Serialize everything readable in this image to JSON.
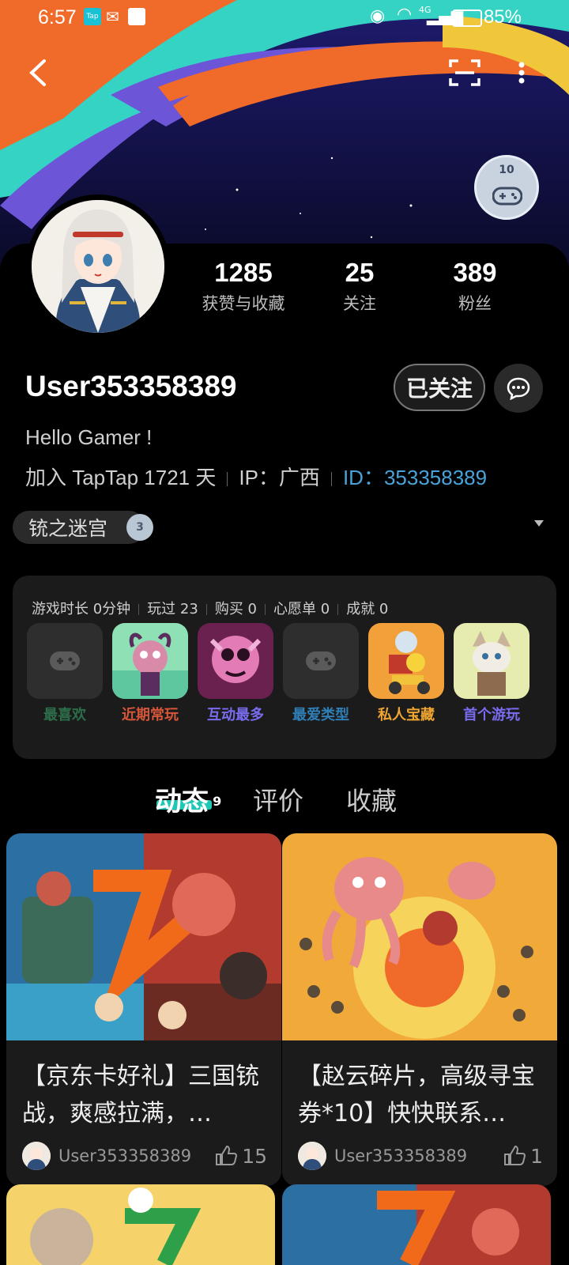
{
  "status_bar": {
    "time": "6:57",
    "battery": "85%",
    "network": "4G"
  },
  "badge": {
    "value": "10"
  },
  "stats": [
    {
      "value": "1285",
      "label": "获赞与收藏"
    },
    {
      "value": "25",
      "label": "关注"
    },
    {
      "value": "389",
      "label": "粉丝"
    }
  ],
  "profile": {
    "username": "User353358389",
    "follow_label": "已关注",
    "bio": "Hello Gamer !",
    "joined": "加入 TapTap 1721 天",
    "ip": "IP：广西",
    "id_label": "ID：",
    "id_value": "353358389",
    "guild": "铳之迷宫",
    "guild_level": "3"
  },
  "game_stats": [
    "游戏时长 0分钟",
    "玩过 23",
    "购买 0",
    "心愿单 0",
    "成就 0"
  ],
  "game_tiles": [
    {
      "label": "最喜欢",
      "color": "#2c6e49"
    },
    {
      "label": "近期常玩",
      "color": "#d6563a"
    },
    {
      "label": "互动最多",
      "color": "#7a6cf0"
    },
    {
      "label": "最爱类型",
      "color": "#2f7fb6"
    },
    {
      "label": "私人宝藏",
      "color": "#f0a630"
    },
    {
      "label": "首个游玩",
      "color": "#7a6cf0"
    }
  ],
  "tabs": [
    {
      "label": "动态",
      "count": "9"
    },
    {
      "label": "评价"
    },
    {
      "label": "收藏"
    }
  ],
  "posts": [
    {
      "title": "【京东卡好礼】三国铳战，爽感拉满，…",
      "user": "User353358389",
      "likes": "15"
    },
    {
      "title": "【赵云碎片，高级寻宝券*10】快快联系…",
      "user": "User353358389",
      "likes": "1"
    }
  ]
}
